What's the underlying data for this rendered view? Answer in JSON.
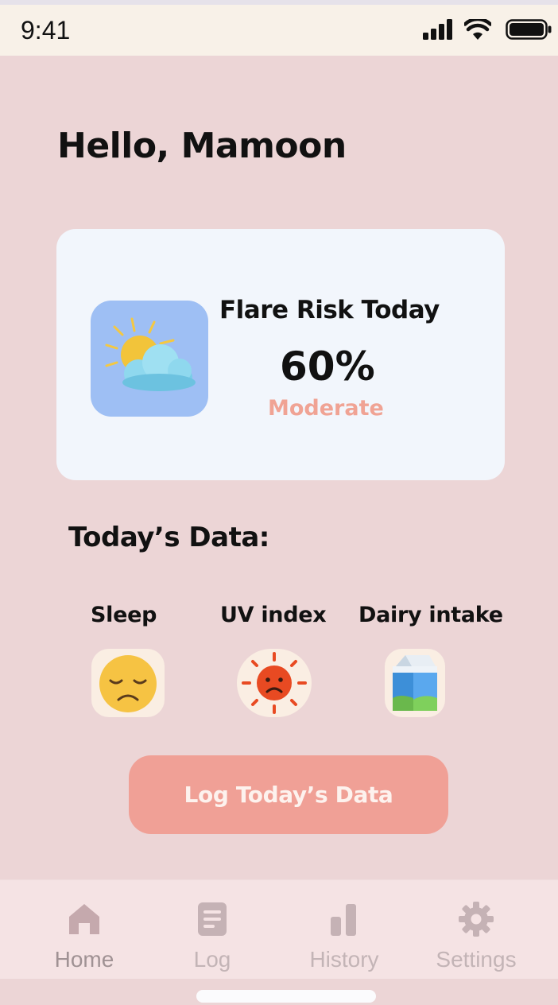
{
  "status_bar": {
    "time": "9:41"
  },
  "header": {
    "greeting": "Hello, Mamoon"
  },
  "risk_card": {
    "title": "Flare Risk Today",
    "percent": "60%",
    "level": "Moderate",
    "icon": "sun-behind-cloud-icon",
    "level_color": "#f0a394"
  },
  "todays_data": {
    "title": "Today’s Data:",
    "items": [
      {
        "label": "Sleep",
        "icon": "sleepy-face-icon"
      },
      {
        "label": "UV index",
        "icon": "frowning-sun-icon"
      },
      {
        "label": "Dairy intake",
        "icon": "milk-carton-icon"
      }
    ]
  },
  "cta": {
    "label": "Log Today’s Data",
    "color": "#f0a096"
  },
  "tab_bar": {
    "tabs": [
      {
        "label": "Home",
        "icon": "home-icon",
        "active": true
      },
      {
        "label": "Log",
        "icon": "document-icon",
        "active": false
      },
      {
        "label": "History",
        "icon": "bar-chart-icon",
        "active": false
      },
      {
        "label": "Settings",
        "icon": "gear-icon",
        "active": false
      }
    ]
  },
  "colors": {
    "background": "#ecd5d6",
    "card": "#f2f6fc",
    "accent": "#f0a096"
  }
}
